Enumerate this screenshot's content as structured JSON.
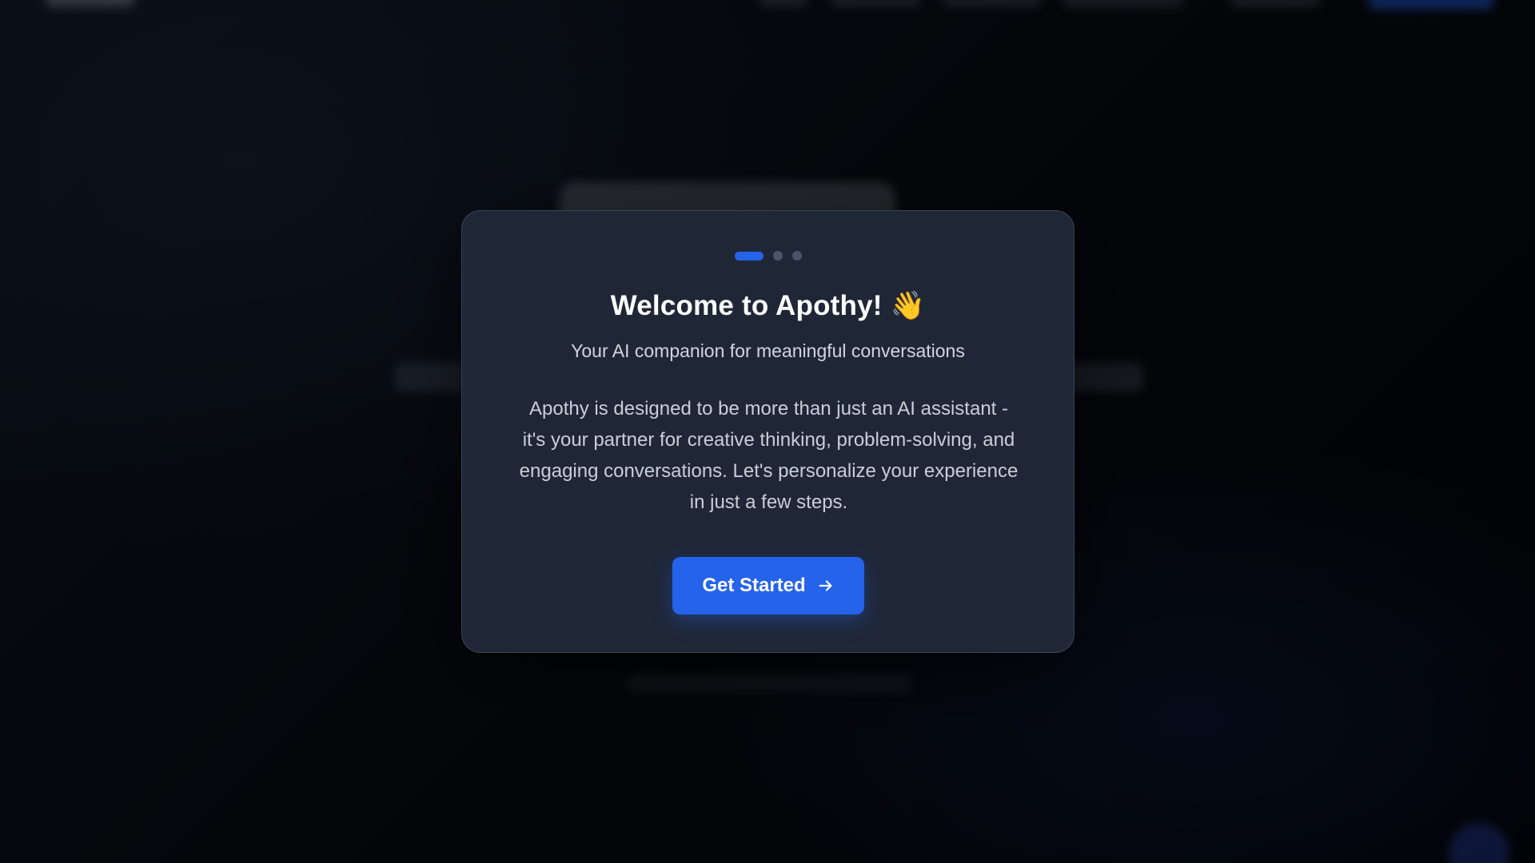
{
  "modal": {
    "steps": {
      "total": 3,
      "current": 1
    },
    "title": "Welcome to Apothy!",
    "title_emoji": "👋",
    "subtitle": "Your AI companion for meaningful conversations",
    "description_lines": [
      "Apothy is designed to be more than just an AI assistant -",
      "it's your partner for creative thinking, problem-solving, and",
      "engaging conversations. Let's personalize your experience",
      "in just a few steps."
    ],
    "cta_label": "Get Started",
    "cta_icon": "arrow-right-icon"
  },
  "colors": {
    "accent": "#2563eb",
    "modal_bg": "#1f2737",
    "step_inactive": "#4b5567",
    "text_primary": "#ffffff",
    "text_secondary": "#c9ced8"
  }
}
